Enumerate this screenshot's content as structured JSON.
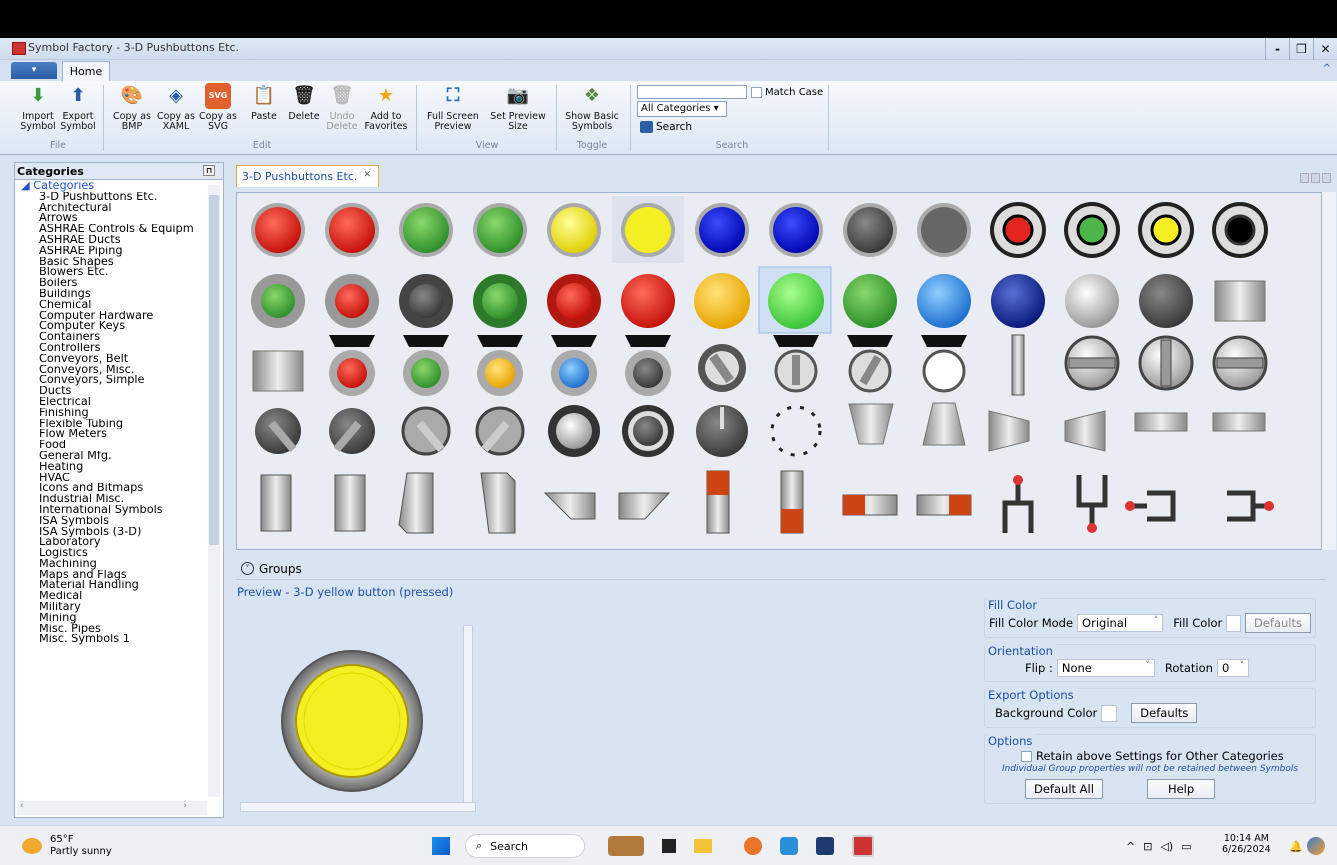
{
  "window": {
    "title": "Symbol Factory - 3-D Pushbuttons Etc.",
    "controls": [
      "-",
      "❒",
      "✕"
    ]
  },
  "ribbon_tabs": {
    "home": "Home"
  },
  "ribbon": {
    "import": "Import Symbol",
    "export": "Export Symbol",
    "copy_bmp": "Copy as BMP",
    "copy_xaml": "Copy as XAML",
    "copy_svg": "Copy as SVG",
    "paste": "Paste",
    "delete": "Delete",
    "undo_delete": "Undo Delete",
    "add_fav": "Add to Favorites",
    "full_screen": "Full Screen Preview",
    "set_preview": "Set Preview Size",
    "show_basic": "Show Basic Symbols",
    "match_case": "Match Case",
    "category_select": "All Categories",
    "search_btn": "Search",
    "svg_badge": "SVG",
    "groups": {
      "file": "File",
      "edit": "Edit",
      "view": "View",
      "toggle": "Toggle",
      "search": "Search"
    }
  },
  "categories": {
    "title": "Categories",
    "root": "Categories",
    "items": [
      "3-D Pushbuttons Etc.",
      "Architectural",
      "Arrows",
      "ASHRAE Controls & Equipm",
      "ASHRAE Ducts",
      "ASHRAE Piping",
      "Basic Shapes",
      "Blowers Etc.",
      "Boilers",
      "Buildings",
      "Chemical",
      "Computer Hardware",
      "Computer Keys",
      "Containers",
      "Controllers",
      "Conveyors, Belt",
      "Conveyors, Misc.",
      "Conveyors, Simple",
      "Ducts",
      "Electrical",
      "Finishing",
      "Flexible Tubing",
      "Flow Meters",
      "Food",
      "General Mfg.",
      "Heating",
      "HVAC",
      "Icons and Bitmaps",
      "Industrial Misc.",
      "International Symbols",
      "ISA Symbols",
      "ISA Symbols (3-D)",
      "Laboratory",
      "Logistics",
      "Machining",
      "Maps and Flags",
      "Material Handling",
      "Medical",
      "Military",
      "Mining",
      "Misc. Pipes",
      "Misc. Symbols 1"
    ]
  },
  "doc_tab": "3-D Pushbuttons Etc.",
  "groups_label": "Groups",
  "preview_label": "Preview - 3-D yellow button (pressed)",
  "options": {
    "fill_color_title": "Fill Color",
    "fill_mode_label": "Fill Color Mode",
    "fill_mode_value": "Original",
    "fill_color_label": "Fill Color",
    "defaults": "Defaults",
    "orientation_title": "Orientation",
    "flip_label": "Flip :",
    "flip_value": "None",
    "rotation_label": "Rotation",
    "rotation_value": "0",
    "export_title": "Export Options",
    "bg_color_label": "Background Color",
    "options_title": "Options",
    "retain_label": "Retain above Settings for Other Categories",
    "retain_note": "Individual Group properties will not be retained between Symbols",
    "default_all": "Default All",
    "help": "Help"
  },
  "taskbar": {
    "temp": "65°F",
    "weather": "Partly sunny",
    "search": "Search",
    "time": "10:14 AM",
    "date": "6/26/2024"
  },
  "colors": {
    "red": "#e0261f",
    "green": "#4cb648",
    "yellow": "#f4ee22",
    "blue": "#0a12d8",
    "accent": "#1a4fa0"
  }
}
